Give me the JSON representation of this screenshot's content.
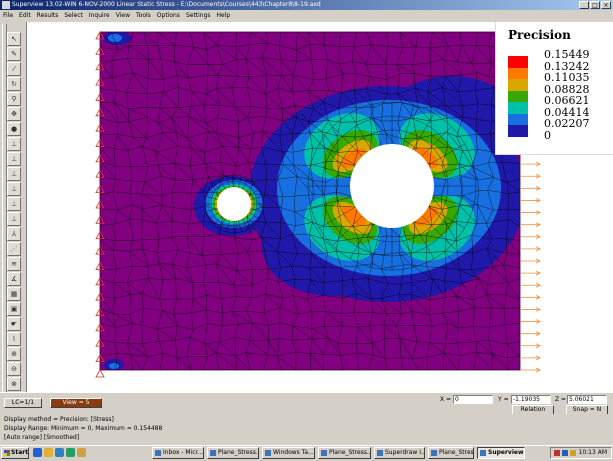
{
  "window": {
    "title": "Superview 13.02-WIN 6-NOV-2000 Linear Static Stress - E:\\Documents\\Courses\\443\\Chapter8\\8-19.axd",
    "controls": [
      "_",
      "□",
      "×"
    ]
  },
  "menu": [
    "File",
    "Edit",
    "Results",
    "Select",
    "Inquire",
    "View",
    "Tools",
    "Options",
    "Settings",
    "Help"
  ],
  "toolbar": {
    "tools": [
      {
        "icon": "select-arrow-icon",
        "glyph": "↖"
      },
      {
        "icon": "pencil-icon",
        "glyph": "✎"
      },
      {
        "icon": "brush-icon",
        "glyph": "⁄"
      },
      {
        "icon": "rotate-icon",
        "glyph": "↻"
      },
      {
        "icon": "zoom-icon",
        "glyph": "⚲"
      },
      {
        "icon": "pan-icon",
        "glyph": "✥"
      },
      {
        "icon": "shade-sphere-icon",
        "glyph": "●"
      },
      {
        "icon": "view-xy-icon",
        "glyph": "⊥"
      },
      {
        "icon": "view-yz-icon",
        "glyph": "⊥"
      },
      {
        "icon": "view-zx-icon",
        "glyph": "⊥"
      },
      {
        "icon": "view-iso-icon",
        "glyph": "⊥"
      },
      {
        "icon": "view-top-icon",
        "glyph": "⊥"
      },
      {
        "icon": "view-bottom-icon",
        "glyph": "⊥"
      },
      {
        "icon": "axes-icon",
        "glyph": "⅄"
      },
      {
        "icon": "mesh-nodes-icon",
        "glyph": "⋰"
      },
      {
        "icon": "load-arrows-icon",
        "glyph": "≋"
      },
      {
        "icon": "measure-icon",
        "glyph": "∡"
      },
      {
        "icon": "grid-icon",
        "glyph": "▦"
      },
      {
        "icon": "box-icon",
        "glyph": "▣"
      },
      {
        "icon": "pointer-icon",
        "glyph": "☛"
      },
      {
        "icon": "eyedropper-icon",
        "glyph": "⌇"
      },
      {
        "icon": "zoom-in-icon",
        "glyph": "⊕"
      },
      {
        "icon": "zoom-out-icon",
        "glyph": "⊖"
      },
      {
        "icon": "zoom-window-icon",
        "glyph": "⊗"
      }
    ]
  },
  "legend": {
    "title": "Precision",
    "entries": [
      {
        "value": "0.15449",
        "color": "#ff0000"
      },
      {
        "value": "0.13242",
        "color": "#ff7800"
      },
      {
        "value": "0.11035",
        "color": "#d8a800"
      },
      {
        "value": "0.08828",
        "color": "#38a800"
      },
      {
        "value": "0.06621",
        "color": "#00c0a8"
      },
      {
        "value": "0.04414",
        "color": "#1870e0"
      },
      {
        "value": "0.02207",
        "color": "#2018a8"
      },
      {
        "value": "0",
        "color": "#800080"
      }
    ]
  },
  "colors": {
    "field": "#800080",
    "mesh": "#000000",
    "hole": "#ffffff",
    "constraint": "#e03020",
    "load": "#f09040"
  },
  "status": {
    "lc_button": "LC=1/1",
    "view_button": "View = 5",
    "x_label": "X =",
    "x_value": "0",
    "y_label": "Y =",
    "y_value": "-1.19035",
    "z_label": "Z =",
    "z_value": "5.06021",
    "relation_button": "Relation",
    "snap_button": "Snap = N"
  },
  "messages": [
    "Display method = Precision: [Stress]",
    "Display Range: Minimum = 0, Maximum = 0.154488",
    "[Auto range] [Smoothed]"
  ],
  "taskbar": {
    "start": "Start",
    "quicklaunch": [
      "ie-icon",
      "outlook-icon",
      "desktop-icon",
      "media-icon",
      "folder-icon"
    ],
    "tasks": [
      {
        "label": "Inbox - Micr...",
        "active": false
      },
      {
        "label": "Plane_Stress...",
        "active": false
      },
      {
        "label": "Windows Ta...",
        "active": false
      },
      {
        "label": "Plane_Stress...",
        "active": false
      },
      {
        "label": "Superdraw I...",
        "active": false
      },
      {
        "label": "Plane_Stress...",
        "active": false
      },
      {
        "label": "Superview ...",
        "active": true
      }
    ],
    "clock": "10:13 AM"
  }
}
